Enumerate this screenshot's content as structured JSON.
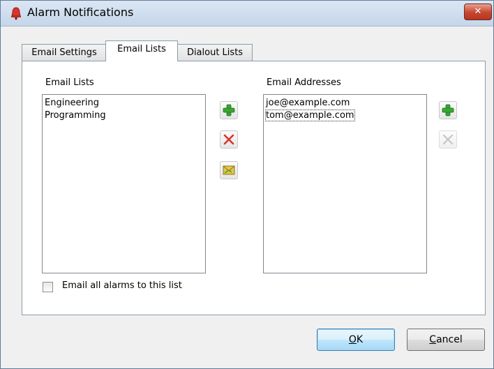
{
  "window": {
    "title": "Alarm Notifications",
    "close_glyph": "✕"
  },
  "tabs": [
    {
      "label": "Email Settings",
      "active": false
    },
    {
      "label": "Email Lists",
      "active": true
    },
    {
      "label": "Dialout Lists",
      "active": false
    }
  ],
  "email_lists": {
    "label": "Email Lists",
    "items": [
      "Engineering",
      "Programming"
    ]
  },
  "email_addresses": {
    "label": "Email Addresses",
    "items": [
      "joe@example.com",
      "tom@example.com"
    ],
    "focused_index": 1
  },
  "list_buttons": {
    "add_icon": "plus-icon",
    "delete_icon": "x-icon",
    "email_icon": "envelope-icon"
  },
  "address_buttons": {
    "add_icon": "plus-icon",
    "delete_icon": "x-icon",
    "delete_enabled": false
  },
  "checkbox": {
    "label": "Email all alarms to this list",
    "checked": false
  },
  "buttons": {
    "ok": {
      "mnemonic": "O",
      "rest": "K"
    },
    "cancel": {
      "mnemonic": "C",
      "rest": "ancel"
    }
  },
  "colors": {
    "green": "#3aa635",
    "red": "#d9342b",
    "yellow": "#e9c446",
    "title_bg": "#c4d6ea"
  }
}
